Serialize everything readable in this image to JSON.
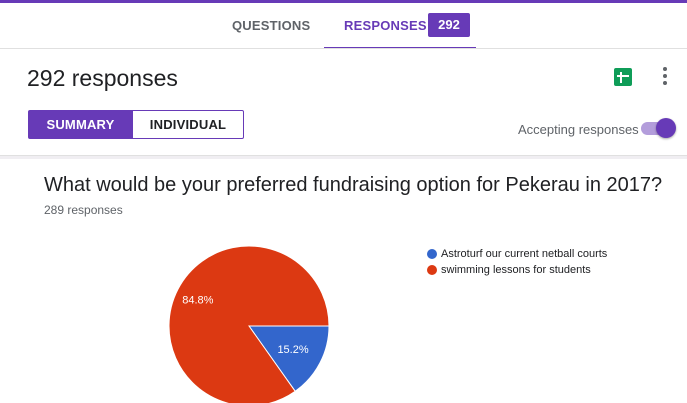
{
  "tabs": {
    "questions": "QUESTIONS",
    "responses": "RESPONSES",
    "responses_count": "292"
  },
  "header": {
    "title": "292 responses",
    "summary_label": "SUMMARY",
    "individual_label": "INDIVIDUAL",
    "accepting_label": "Accepting responses",
    "accepting_on": true
  },
  "icons": {
    "sheets": "google-sheets-icon",
    "more": "more-vertical-icon"
  },
  "colors": {
    "accent": "#673ab7",
    "sheets": "#0f9d58"
  },
  "question": {
    "title": "What would be your preferred fundraising option for Pekerau in 2017?",
    "subtitle": "289 responses"
  },
  "chart_data": {
    "type": "pie",
    "categories": [
      "Astroturf our current netball courts",
      "swimming lessons for students"
    ],
    "values": [
      15.2,
      84.8
    ],
    "labels": [
      "15.2%",
      "84.8%"
    ],
    "colors": [
      "#3366cc",
      "#dc3912"
    ],
    "legend": "right"
  }
}
